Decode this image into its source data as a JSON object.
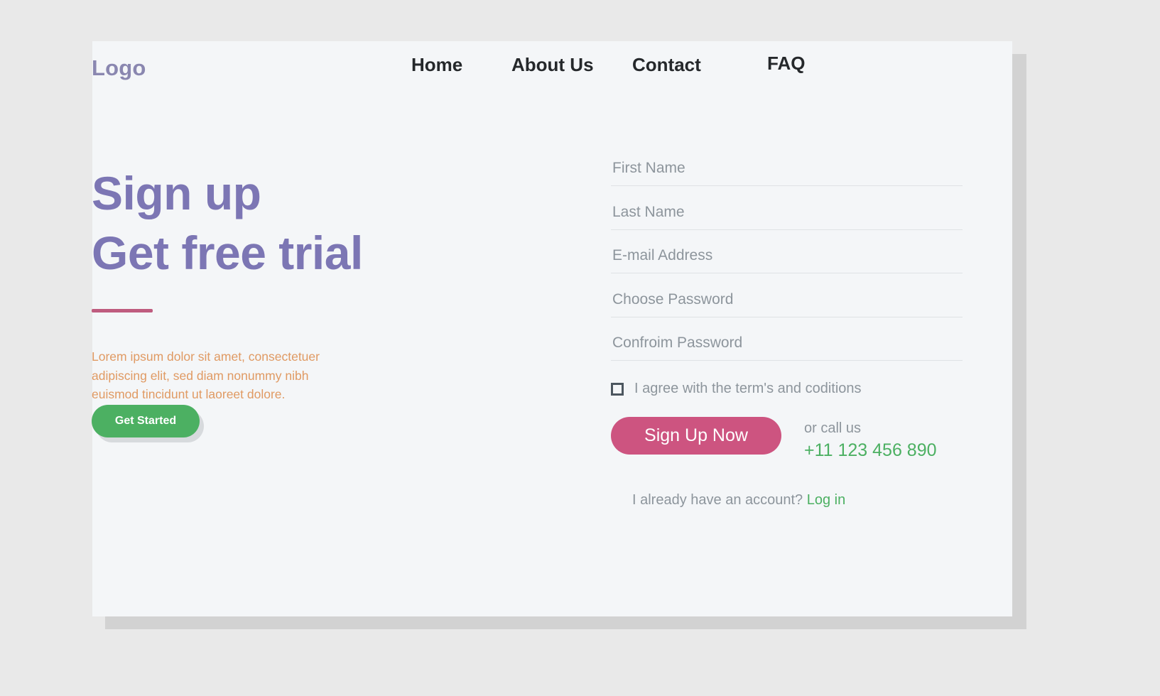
{
  "header": {
    "logo": "Logo",
    "nav": [
      {
        "id": "home",
        "label": "Home"
      },
      {
        "id": "about",
        "label": "About Us"
      },
      {
        "id": "contact",
        "label": "Contact"
      },
      {
        "id": "faq",
        "label": "FAQ"
      }
    ]
  },
  "hero": {
    "title_line1": "Sign up",
    "title_line2": "Get free trial",
    "paragraph": "Lorem ipsum dolor sit amet, consectetuer adipiscing elit, sed diam nonummy nibh euismod tincidunt ut laoreet dolore.",
    "cta_label": "Get Started"
  },
  "form": {
    "fields": [
      {
        "id": "first-name",
        "placeholder": "First Name",
        "value": ""
      },
      {
        "id": "last-name",
        "placeholder": "Last Name",
        "value": ""
      },
      {
        "id": "email",
        "placeholder": "E-mail Address",
        "value": ""
      },
      {
        "id": "password",
        "placeholder": "Choose Password",
        "value": ""
      },
      {
        "id": "confirm-password",
        "placeholder": "Confroim Password",
        "value": ""
      }
    ],
    "terms_label": "I agree with the term's and coditions",
    "terms_checked": false,
    "submit_label": "Sign Up Now",
    "call_label": "or call us",
    "phone": "+11 123 456 890",
    "login_prompt": "I already have an account?",
    "login_link": "Log in"
  },
  "colors": {
    "page_background": "#e9e9e9",
    "card_background": "#f4f6f8",
    "heading_purple": "#7c76b4",
    "accent_pink": "#bf5c7f",
    "paragraph_orange": "#e09a63",
    "green": "#4cb062",
    "magenta": "#cd5480",
    "placeholder_gray": "#8d959c",
    "nav_dark": "#25282b"
  }
}
